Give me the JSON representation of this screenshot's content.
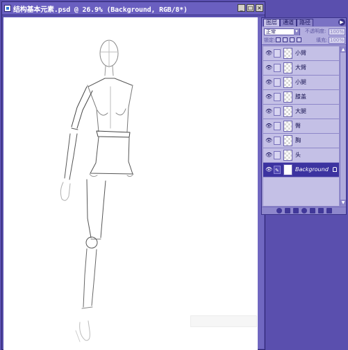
{
  "document": {
    "title": "结构基本元素.psd @ 26.9% (Background, RGB/8*)"
  },
  "window_controls": {
    "minimize": "_",
    "maximize": "□",
    "close": "×"
  },
  "layers_panel": {
    "tabs": [
      "图层",
      "通道",
      "路径"
    ],
    "blend_mode": "正常",
    "opacity_label": "不透明度:",
    "opacity_value": "100%",
    "lock_label": "锁定:",
    "fill_label": "填充:",
    "fill_value": "100%",
    "layers": [
      {
        "name": "小臂",
        "visible": true,
        "selected": false
      },
      {
        "name": "大臂",
        "visible": true,
        "selected": false
      },
      {
        "name": "小腿",
        "visible": true,
        "selected": false
      },
      {
        "name": "膝盖",
        "visible": true,
        "selected": false
      },
      {
        "name": "大腿",
        "visible": true,
        "selected": false
      },
      {
        "name": "臀",
        "visible": true,
        "selected": false
      },
      {
        "name": "胸",
        "visible": true,
        "selected": false
      },
      {
        "name": "头",
        "visible": true,
        "selected": false
      },
      {
        "name": "Background",
        "visible": true,
        "selected": true
      }
    ]
  },
  "colors": {
    "workspace": "#5a4fae",
    "selected_layer": "#3c33a0",
    "panel": "#9b95cf"
  }
}
